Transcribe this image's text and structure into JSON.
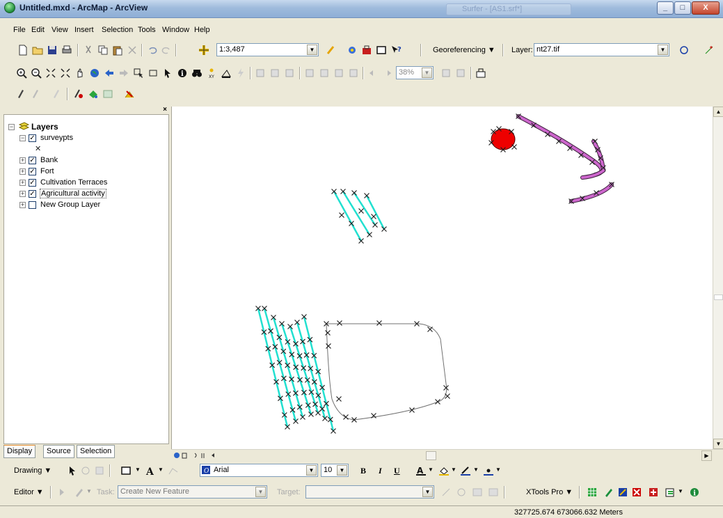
{
  "window": {
    "title": "Untitled.mxd - ArcMap - ArcView",
    "ghost_tab_1": "Surfer - [AS1.srf*]",
    "minimize": "_",
    "maximize": "□",
    "close": "X"
  },
  "menu": [
    "File",
    "Edit",
    "View",
    "Insert",
    "Selection",
    "Tools",
    "Window",
    "Help"
  ],
  "standard_toolbar": {
    "scale_value": "1:3,487",
    "georeferencing_label": "Georeferencing ▼",
    "layer_label": "Layer:",
    "layer_value": "nt27.tif"
  },
  "tools_toolbar": {
    "zoom_percent": "38%"
  },
  "toc": {
    "root": "Layers",
    "layers": [
      {
        "label": "surveypts",
        "checked": true,
        "expanded": true
      },
      {
        "label": "Bank",
        "checked": true
      },
      {
        "label": "Fort",
        "checked": true
      },
      {
        "label": "Cultivation Terraces",
        "checked": true
      },
      {
        "label": "Agricultural activity",
        "checked": true
      },
      {
        "label": "New Group Layer",
        "checked": false
      }
    ],
    "surveypts_symbol": "✕",
    "tabs": [
      "Display",
      "Source",
      "Selection"
    ]
  },
  "drawing_toolbar": {
    "drawing_label": "Drawing ▼",
    "font_name": "Arial",
    "font_size": "10",
    "bold": "B",
    "italic": "I",
    "underline": "U"
  },
  "editor_toolbar": {
    "editor_label": "Editor ▼",
    "task_label": "Task:",
    "task_value": "Create New Feature",
    "target_label": "Target:",
    "xtools_label": "XTools Pro ▼"
  },
  "status": {
    "coordinates": "327725.674  673066.632 Meters"
  },
  "colors": {
    "terraces": "#22e0d0",
    "bank": "#cc66cc",
    "fort": "#ee0000",
    "agri": "#707070",
    "marker": "#222222"
  }
}
